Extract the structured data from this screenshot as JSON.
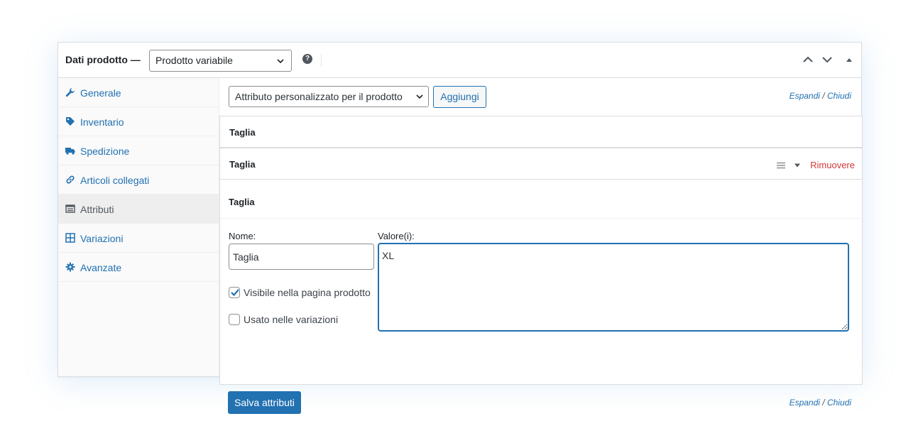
{
  "header": {
    "title": "Dati prodotto —",
    "product_type": "Prodotto variabile",
    "help_icon": "question-mark-icon",
    "controls": [
      "move-up-icon",
      "move-down-icon",
      "toggle-panel-icon"
    ]
  },
  "sidebar": {
    "items": [
      {
        "label": "Generale",
        "icon": "wrench-icon",
        "active": false
      },
      {
        "label": "Inventario",
        "icon": "tag-icon",
        "active": false
      },
      {
        "label": "Spedizione",
        "icon": "truck-icon",
        "active": false
      },
      {
        "label": "Articoli collegati",
        "icon": "link-icon",
        "active": false
      },
      {
        "label": "Attributi",
        "icon": "list-view-icon",
        "active": true
      },
      {
        "label": "Variazioni",
        "icon": "grid-icon",
        "active": false
      },
      {
        "label": "Avanzate",
        "icon": "gear-icon",
        "active": false
      }
    ]
  },
  "toolbar": {
    "attribute_select": "Attributo personalizzato per il prodotto",
    "add_label": "Aggiungi",
    "expand_label": "Espandi",
    "separator": "/",
    "close_label": "Chiudi"
  },
  "attributes": {
    "row1_title": "Taglia",
    "row2_title": "Taglia",
    "remove_label": "Rimuovere",
    "sub_title": "Taglia",
    "name_label": "Nome:",
    "name_value": "Taglia",
    "values_label": "Valore(i):",
    "values_value": "XL",
    "visible_label": "Visibile nella pagina prodotto",
    "visible_checked": true,
    "variations_label": "Usato nelle variazioni",
    "variations_checked": false
  },
  "footer": {
    "save_label": "Salva attributi",
    "expand_label": "Espandi",
    "separator": "/",
    "close_label": "Chiudi"
  },
  "colors": {
    "accent": "#2271b1",
    "danger": "#d63638",
    "active_tab_bg": "#eeeeee"
  }
}
